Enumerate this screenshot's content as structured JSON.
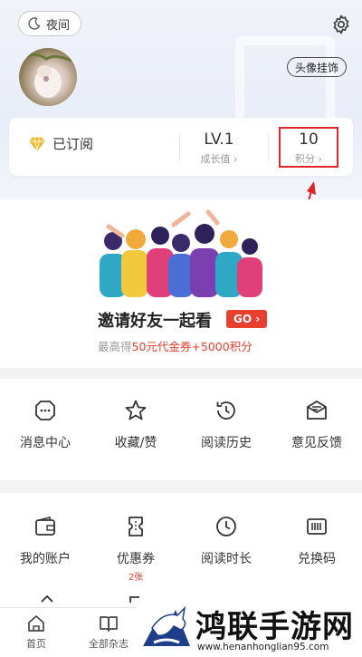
{
  "header": {
    "night_mode_label": "夜间",
    "avatar_frame_label": "头像挂饰"
  },
  "stats": {
    "subscribed_label": "已订阅",
    "level_value": "LV.1",
    "level_label": "成长值 ›",
    "points_value": "10",
    "points_label": "积分 ›"
  },
  "invite": {
    "title": "邀请好友一起看",
    "go_label": "GO ›",
    "sub_prefix": "最高得",
    "sub_highlight": "50元代金券+5000积分"
  },
  "grid1": [
    {
      "label": "消息中心",
      "icon": "message-icon"
    },
    {
      "label": "收藏/赞",
      "icon": "star-icon"
    },
    {
      "label": "阅读历史",
      "icon": "history-icon"
    },
    {
      "label": "意见反馈",
      "icon": "feedback-icon"
    }
  ],
  "grid2": [
    {
      "label": "我的账户",
      "icon": "wallet-icon",
      "badge": ""
    },
    {
      "label": "优惠券",
      "icon": "coupon-icon",
      "badge": "2张"
    },
    {
      "label": "阅读时长",
      "icon": "clock-icon",
      "badge": ""
    },
    {
      "label": "兑换码",
      "icon": "barcode-icon",
      "badge": ""
    }
  ],
  "tabbar": [
    {
      "label": "首页",
      "icon": "home-icon"
    },
    {
      "label": "全部杂志",
      "icon": "book-icon"
    }
  ],
  "watermark": {
    "title": "鸿联手游网",
    "url": "www.henanhonglian95.com"
  },
  "colors": {
    "accent_red": "#e8402f",
    "highlight_box": "#e0242b"
  }
}
